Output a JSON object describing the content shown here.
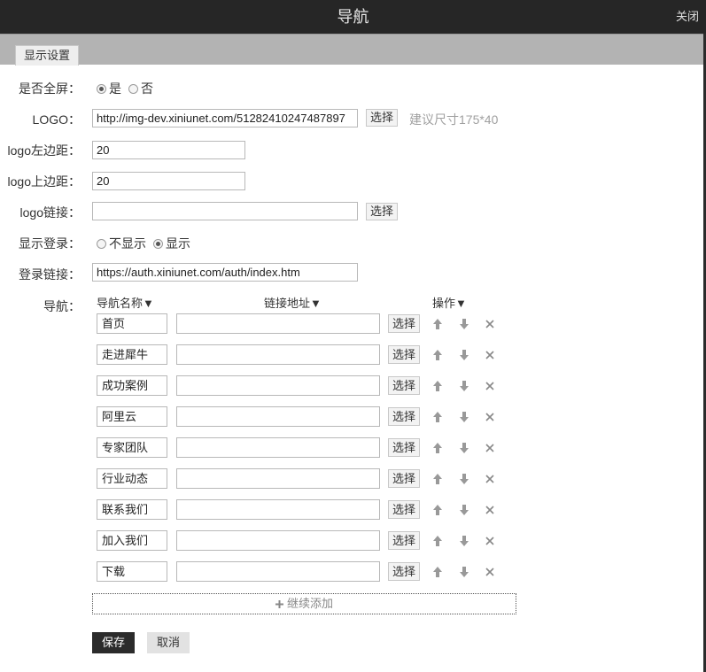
{
  "window": {
    "title": "导航",
    "close_label": "关闭"
  },
  "tabs": [
    {
      "label": "显示设置",
      "active": true
    }
  ],
  "form": {
    "fullscreen": {
      "label": "是否全屏：",
      "options": [
        "是",
        "否"
      ],
      "selected": "是"
    },
    "logo": {
      "label": "LOGO：",
      "value": "http://img-dev.xiniunet.com/51282410247487897",
      "select_label": "选择",
      "hint": "建议尺寸175*40"
    },
    "logo_left": {
      "label": "logo左边距：",
      "value": "20"
    },
    "logo_top": {
      "label": "logo上边距：",
      "value": "20"
    },
    "logo_link": {
      "label": "logo链接：",
      "value": "",
      "select_label": "选择"
    },
    "show_login": {
      "label": "显示登录：",
      "options": [
        "不显示",
        "显示"
      ],
      "selected": "显示"
    },
    "login_link": {
      "label": "登录链接：",
      "value": "https://auth.xiniunet.com/auth/index.htm"
    }
  },
  "nav": {
    "label": "导航：",
    "columns": {
      "name": "导航名称▼",
      "url": "链接地址▼",
      "ops": "操作▼"
    },
    "select_label": "选择",
    "items": [
      {
        "name": "首页",
        "url": ""
      },
      {
        "name": "走进犀牛",
        "url": ""
      },
      {
        "name": "成功案例",
        "url": ""
      },
      {
        "name": "阿里云",
        "url": ""
      },
      {
        "name": "专家团队",
        "url": ""
      },
      {
        "name": "行业动态",
        "url": ""
      },
      {
        "name": "联系我们",
        "url": ""
      },
      {
        "name": "加入我们",
        "url": ""
      },
      {
        "name": "下载",
        "url": ""
      }
    ],
    "add_label": "继续添加"
  },
  "actions": {
    "save_label": "保存",
    "cancel_label": "取消"
  },
  "icons": {
    "up": "arrow-up-icon",
    "down": "arrow-down-icon",
    "remove": "close-icon",
    "add": "plus-icon"
  }
}
